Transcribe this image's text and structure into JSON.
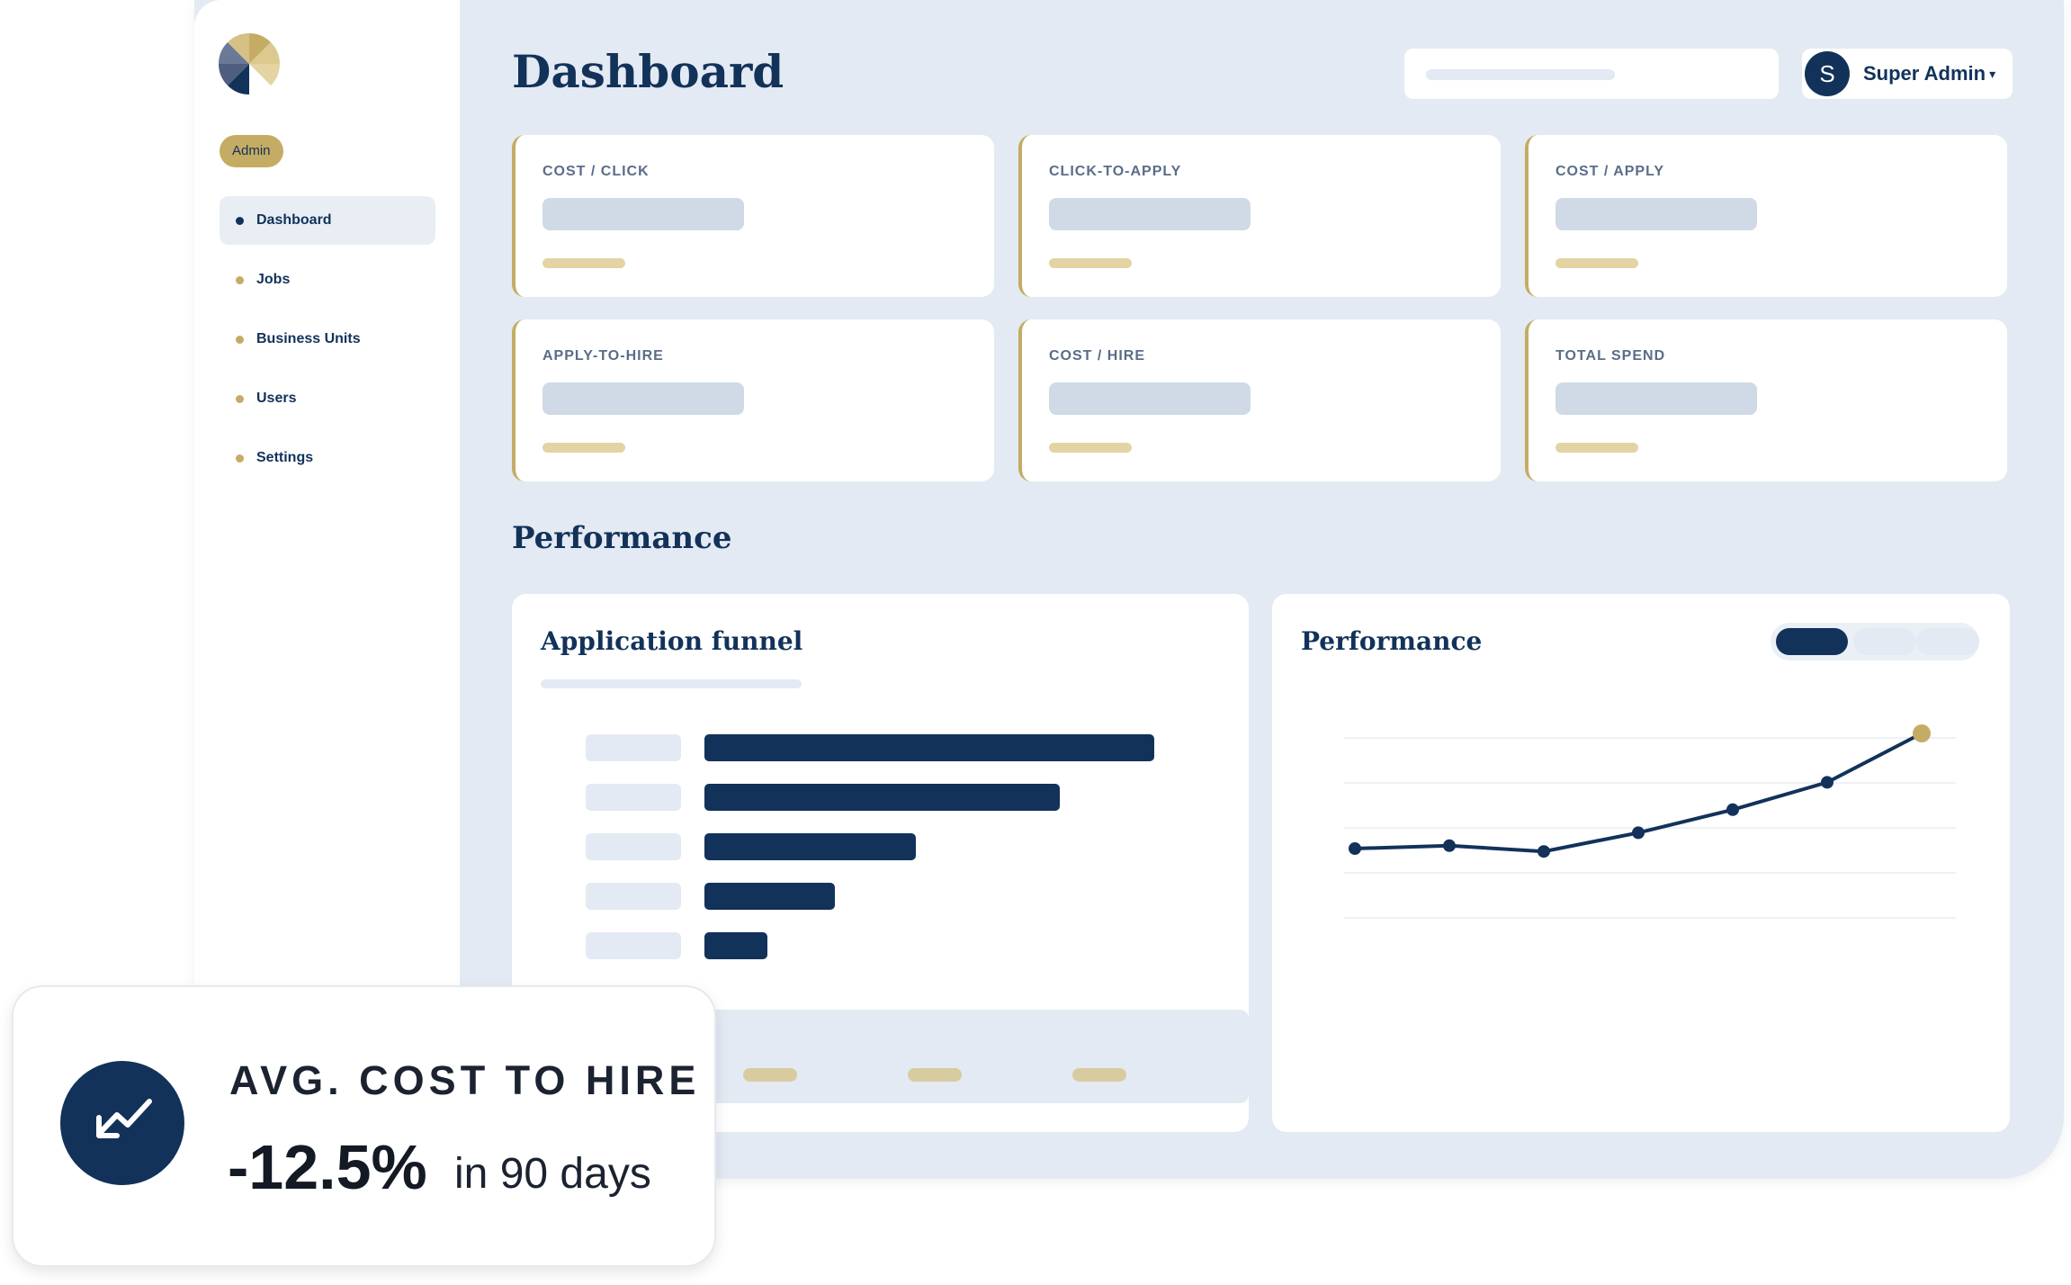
{
  "sidebar": {
    "role_badge": "Admin",
    "items": [
      {
        "label": "Dashboard",
        "active": true
      },
      {
        "label": "Jobs"
      },
      {
        "label": "Business Units"
      },
      {
        "label": "Users"
      },
      {
        "label": "Settings"
      }
    ]
  },
  "header": {
    "title": "Dashboard",
    "user": {
      "initial": "S",
      "name": "Super Admin",
      "caret": "▾"
    }
  },
  "kpis": [
    {
      "label": "COST / CLICK"
    },
    {
      "label": "CLICK-TO-APPLY"
    },
    {
      "label": "COST / APPLY"
    },
    {
      "label": "APPLY-TO-HIRE"
    },
    {
      "label": "COST / HIRE"
    },
    {
      "label": "TOTAL SPEND"
    }
  ],
  "section": {
    "title": "Performance"
  },
  "panels": {
    "funnel": {
      "title": "Application funnel"
    },
    "performance": {
      "title": "Performance"
    }
  },
  "stat": {
    "label": "AVG. COST TO HIRE",
    "value": "-12.5%",
    "suffix": "in 90 days"
  },
  "colors": {
    "navy": "#12325a",
    "gold": "#c5ac64",
    "background": "#e3eaf3"
  },
  "chart_data": [
    {
      "type": "bar",
      "orientation": "horizontal",
      "title": "Application funnel",
      "categories": [
        "",
        "",
        "",
        "",
        ""
      ],
      "values": [
        100,
        79,
        47,
        29,
        14
      ]
    },
    {
      "type": "line",
      "title": "Performance",
      "x": [
        1,
        2,
        3,
        4,
        5,
        6,
        7
      ],
      "values": [
        20,
        22,
        18,
        31,
        47,
        66,
        100
      ],
      "highlight_last_point": true
    }
  ]
}
